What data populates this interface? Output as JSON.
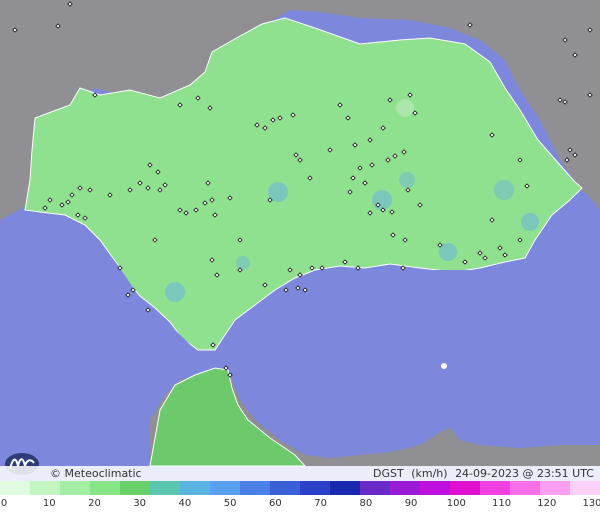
{
  "map": {
    "brand": "© Meteoclimatic",
    "variable": "DGST",
    "unit": "(km/h)",
    "timestamp": "24-09-2023 @ 23:51 UTC"
  },
  "legend": {
    "ticks": [
      "0",
      "10",
      "20",
      "30",
      "40",
      "50",
      "60",
      "70",
      "80",
      "90",
      "100",
      "110",
      "120",
      "130"
    ],
    "colors": [
      "#e0fbe0",
      "#c2f5c2",
      "#a4eea4",
      "#86e686",
      "#6ad16a",
      "#5bc6b0",
      "#5ab4e0",
      "#5aa0f0",
      "#4a80e8",
      "#3a60d8",
      "#2a40c8",
      "#1a2ab0",
      "#6a2ac8",
      "#9a1ad8",
      "#c010e0",
      "#e010d0",
      "#f040e0",
      "#f870e8",
      "#fba0f0",
      "#fdd0f8"
    ]
  }
}
